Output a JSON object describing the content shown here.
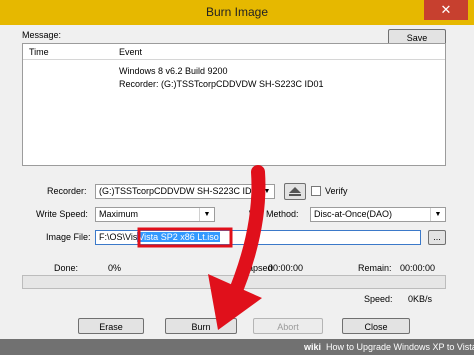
{
  "window": {
    "title": "Burn Image",
    "close_glyph": "✕"
  },
  "log": {
    "label": "Message:",
    "save_label": "Save",
    "columns": [
      "Time",
      "Event"
    ],
    "lines": [
      "Windows 8 v6.2 Build 9200",
      "Recorder: (G:)TSSTcorpCDDVDW SH-S223C ID01"
    ]
  },
  "recorder": {
    "label": "Recorder:",
    "value": "(G:)TSSTcorpCDDVDW SH-S223C ID01",
    "verify_label": "Verify",
    "verify_checked": false
  },
  "write_speed": {
    "label": "Write Speed:",
    "value": "Maximum"
  },
  "write_method": {
    "label": "W",
    "label_rest": "Method:",
    "value": "Disc-at-Once(DAO)"
  },
  "image_file": {
    "label": "Image File:",
    "value_prefix": "F:\\OS\\Vis",
    "value_highlight": "Vista SP2 x86 Lt.iso",
    "browse_label": "..."
  },
  "progress": {
    "done_label": "Done:",
    "done_value": "0%",
    "elapsed_label": "Elapsed",
    "elapsed_value": "00:00:00",
    "remain_label": "Remain:",
    "remain_value": "00:00:00",
    "speed_label": "Speed:",
    "speed_value": "0KB/s",
    "fraction": 0
  },
  "buttons": {
    "erase": "Erase",
    "burn": "Burn",
    "abort": "Abort",
    "close": "Close"
  },
  "footer": {
    "logo": "wiki",
    "caption": "How to Upgrade Windows XP to Vista"
  },
  "colors": {
    "title_bar": "#e6b800",
    "annotation": "#e0101b",
    "progress_fill": "#06b025"
  }
}
